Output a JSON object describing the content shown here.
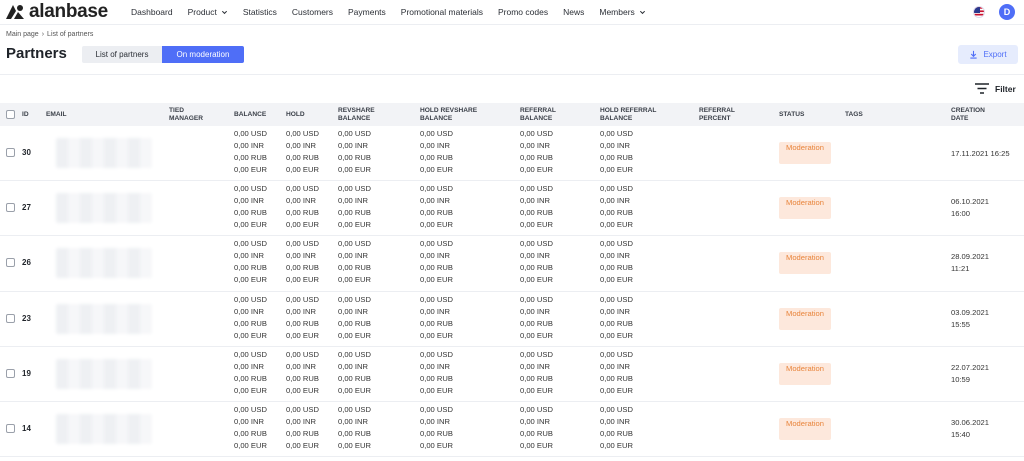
{
  "brand": {
    "name": "alanbase"
  },
  "nav": {
    "items": [
      {
        "label": "Dashboard",
        "has_dropdown": false
      },
      {
        "label": "Product",
        "has_dropdown": true
      },
      {
        "label": "Statistics",
        "has_dropdown": false
      },
      {
        "label": "Customers",
        "has_dropdown": false
      },
      {
        "label": "Payments",
        "has_dropdown": false
      },
      {
        "label": "Promotional materials",
        "has_dropdown": false
      },
      {
        "label": "Promo codes",
        "has_dropdown": false
      },
      {
        "label": "News",
        "has_dropdown": false
      },
      {
        "label": "Members",
        "has_dropdown": true
      }
    ],
    "avatar_initial": "D"
  },
  "breadcrumb": {
    "home": "Main page",
    "current": "List of partners"
  },
  "page": {
    "title": "Partners"
  },
  "tabs": {
    "list": "List of partners",
    "moderation": "On moderation"
  },
  "actions": {
    "export": "Export",
    "filter": "Filter"
  },
  "colors": {
    "accent": "#4f6ef7",
    "status_bg": "#fde8dc",
    "status_text": "#e8843b"
  },
  "table": {
    "headers": {
      "id": "ID",
      "email": "EMAIL",
      "tied_manager": "TIED MANAGER",
      "balance": "BALANCE",
      "hold": "HOLD",
      "revshare_balance": "REVSHARE BALANCE",
      "hold_revshare_balance": "HOLD REVSHARE BALANCE",
      "referral_balance": "REFERRAL BALANCE",
      "hold_referral_balance": "HOLD REFERRAL BALANCE",
      "referral_percent": "REFERRAL PERCENT",
      "status": "STATUS",
      "tags": "TAGS",
      "creation_date": "CREATION DATE"
    },
    "rows": [
      {
        "id": "30",
        "date": "17.11.2021 16:25",
        "status": "Moderation",
        "amounts": [
          "0,00 USD",
          "0,00 INR",
          "0,00 RUB",
          "0,00 EUR"
        ]
      },
      {
        "id": "27",
        "date": "06.10.2021 16:00",
        "status": "Moderation",
        "amounts": [
          "0,00 USD",
          "0,00 INR",
          "0,00 RUB",
          "0,00 EUR"
        ]
      },
      {
        "id": "26",
        "date": "28.09.2021 11:21",
        "status": "Moderation",
        "amounts": [
          "0,00 USD",
          "0,00 INR",
          "0,00 RUB",
          "0,00 EUR"
        ]
      },
      {
        "id": "23",
        "date": "03.09.2021 15:55",
        "status": "Moderation",
        "amounts": [
          "0,00 USD",
          "0,00 INR",
          "0,00 RUB",
          "0,00 EUR"
        ]
      },
      {
        "id": "19",
        "date": "22.07.2021 10:59",
        "status": "Moderation",
        "amounts": [
          "0,00 USD",
          "0,00 INR",
          "0,00 RUB",
          "0,00 EUR"
        ]
      },
      {
        "id": "14",
        "date": "30.06.2021 15:40",
        "status": "Moderation",
        "amounts": [
          "0,00 USD",
          "0,00 INR",
          "0,00 RUB",
          "0,00 EUR"
        ]
      }
    ]
  }
}
